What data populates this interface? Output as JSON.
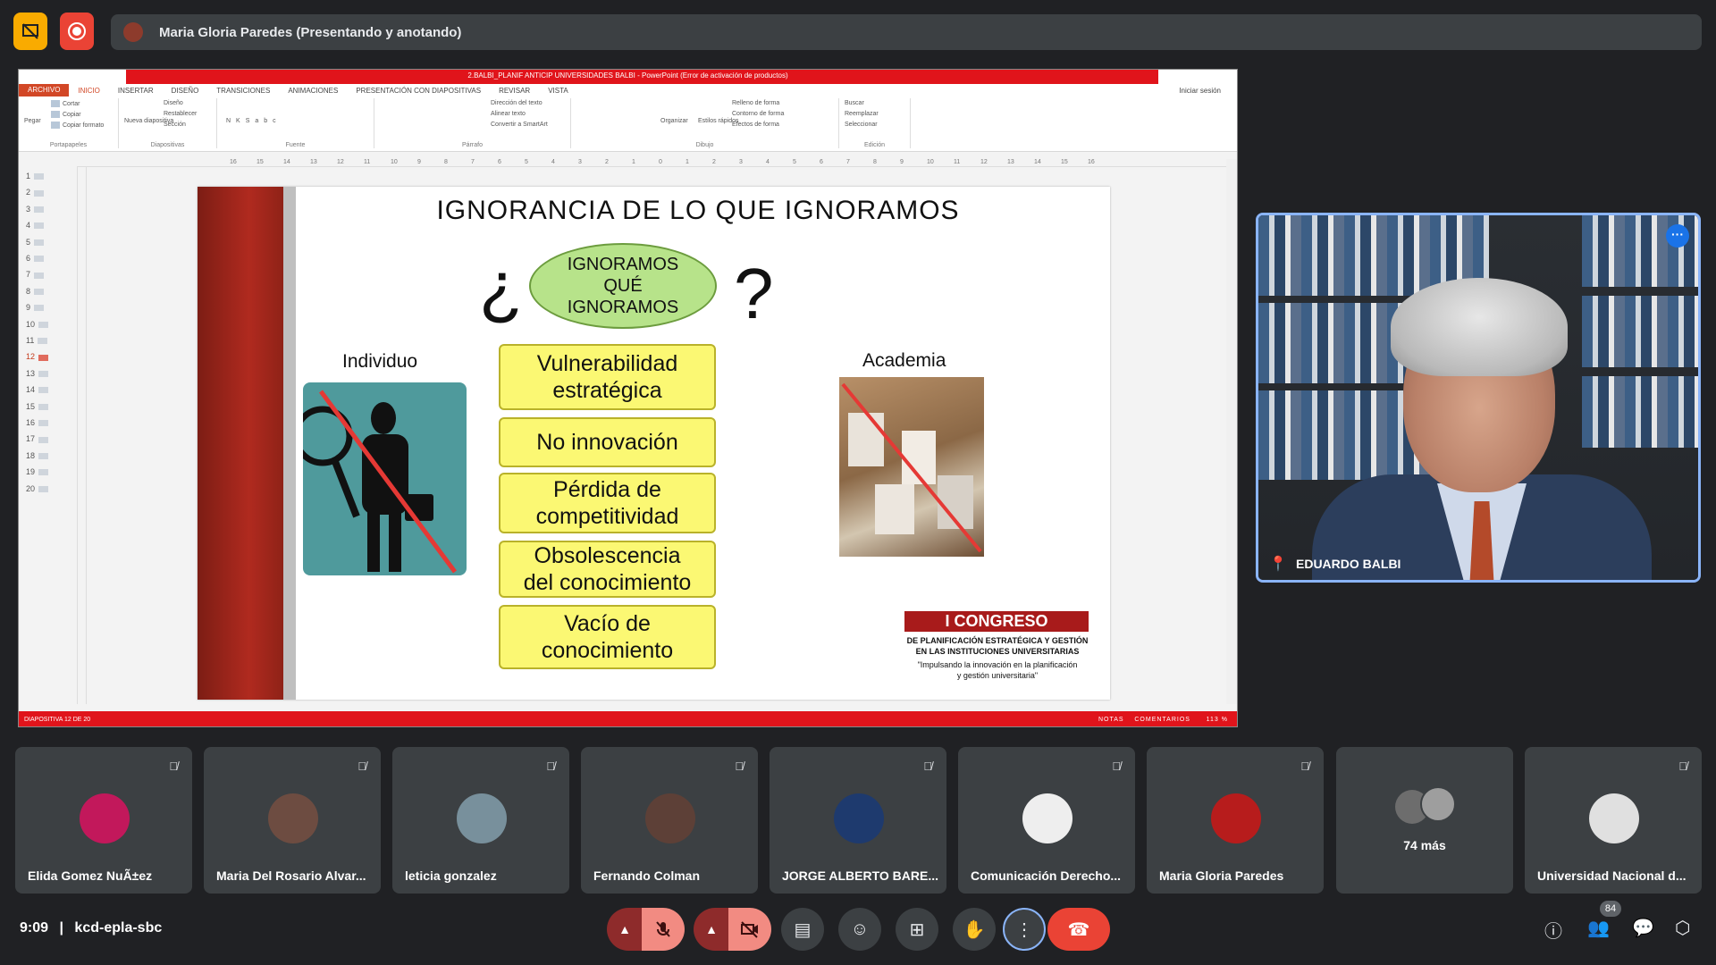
{
  "top": {
    "presenter_label": "Maria Gloria Paredes (Presentando y anotando)"
  },
  "ppt": {
    "window_title": "2.BALBI_PLANIF ANTICIP UNIVERSIDADES BALBI - PowerPoint (Error de activación de productos)",
    "tabs": [
      "ARCHIVO",
      "INICIO",
      "INSERTAR",
      "DISEÑO",
      "TRANSICIONES",
      "ANIMACIONES",
      "PRESENTACIÓN CON DIAPOSITIVAS",
      "REVISAR",
      "VISTA"
    ],
    "login": "Iniciar sesión",
    "ribbon": {
      "paste": "Pegar",
      "cut": "Cortar",
      "copy": "Copiar",
      "format_copy": "Copiar formato",
      "clipboard": "Portapapeles",
      "new_slide": "Nueva diapositiva",
      "layout": "Diseño",
      "reset": "Restablecer",
      "section": "Sección",
      "slides": "Diapositivas",
      "font": "Fuente",
      "text_dir": "Dirección del texto",
      "align_text": "Alinear texto",
      "smartart": "Convertir a SmartArt",
      "paragraph": "Párrafo",
      "arrange": "Organizar",
      "quick_styles": "Estilos rápidos",
      "shape_fill": "Relleno de forma",
      "shape_outline": "Contorno de forma",
      "shape_effects": "Efectos de forma",
      "drawing": "Dibujo",
      "find": "Buscar",
      "replace": "Reemplazar",
      "select": "Seleccionar",
      "editing": "Edición"
    },
    "ruler_ticks": [
      "16",
      "15",
      "14",
      "13",
      "12",
      "11",
      "10",
      "9",
      "8",
      "7",
      "6",
      "5",
      "4",
      "3",
      "2",
      "1",
      "0",
      "1",
      "2",
      "3",
      "4",
      "5",
      "6",
      "7",
      "8",
      "9",
      "10",
      "11",
      "12",
      "13",
      "14",
      "15",
      "16"
    ],
    "thumbs": [
      "1",
      "2",
      "3",
      "4",
      "5",
      "6",
      "7",
      "8",
      "9",
      "10",
      "11",
      "12",
      "13",
      "14",
      "15",
      "16",
      "17",
      "18",
      "19",
      "20"
    ],
    "selected_thumb": "12",
    "status_left": "DIAPOSITIVA 12 DE 20",
    "status_notes": "NOTAS",
    "status_comments": "COMENTARIOS",
    "zoom": "113 %"
  },
  "slide": {
    "title": "IGNORANCIA DE LO QUE IGNORAMOS",
    "q_open": "¿",
    "q_close": "?",
    "oval_lines": [
      "IGNORAMOS",
      "QUÉ",
      "IGNORAMOS"
    ],
    "left_label": "Individuo",
    "right_label": "Academia",
    "boxes": [
      {
        "l1": "Vulnerabilidad",
        "l2": "estratégica"
      },
      {
        "l1": "No  innovación",
        "l2": ""
      },
      {
        "l1": "Pérdida de",
        "l2": "competitividad"
      },
      {
        "l1": "Obsolescencia",
        "l2": "del conocimiento"
      },
      {
        "l1": "Vacío de",
        "l2": "conocimiento"
      }
    ],
    "congreso_title": "I CONGRESO",
    "congreso_sub1": "DE PLANIFICACIÓN ESTRATÉGICA Y GESTIÓN",
    "congreso_sub2": "EN LAS INSTITUCIONES UNIVERSITARIAS",
    "congreso_tag1": "\"Impulsando la innovación en la planificación",
    "congreso_tag2": "y gestión universitaria\""
  },
  "speaker": {
    "name": "EDUARDO BALBI"
  },
  "participants": [
    {
      "name": "Elida Gomez NuÃ±ez",
      "color": "#c2185b"
    },
    {
      "name": "Maria Del Rosario Alvar...",
      "color": "#6d4c41"
    },
    {
      "name": "leticia gonzalez",
      "color": "#78909c"
    },
    {
      "name": "Fernando Colman",
      "color": "#5d4037"
    },
    {
      "name": "JORGE ALBERTO BARE...",
      "color": "#1e3a6e"
    },
    {
      "name": "Comunicación Derecho...",
      "color": "#eeeeee"
    },
    {
      "name": "Maria Gloria Paredes",
      "color": "#b71c1c"
    },
    {
      "name": "Universidad Nacional d...",
      "color": "#e0e0e0"
    }
  ],
  "more_label": "74 más",
  "bottom": {
    "time": "9:09",
    "separator": "|",
    "meeting_code": "kcd-epla-sbc",
    "people_count": "84"
  },
  "colors": {
    "accent_blue": "#8ab4f8",
    "ppt_red": "#e0141b",
    "end_call": "#ea4335"
  }
}
